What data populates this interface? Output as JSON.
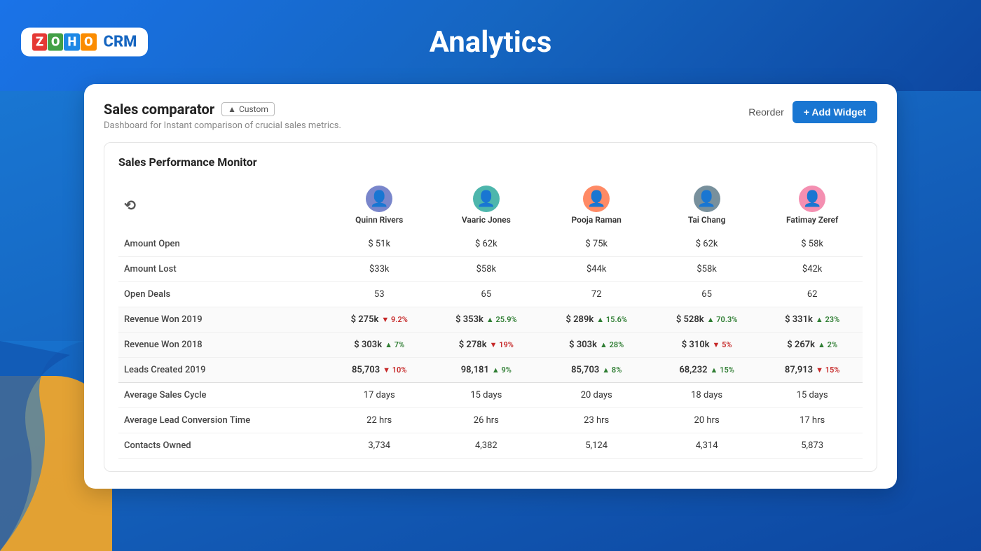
{
  "header": {
    "title": "Analytics",
    "logo_letters": [
      "Z",
      "O",
      "H",
      "O"
    ],
    "crm_text": "CRM"
  },
  "dashboard": {
    "title": "Sales comparator",
    "badge": "Custom",
    "subtitle": "Dashboard for Instant comparison of crucial sales metrics.",
    "reorder_label": "Reorder",
    "add_widget_label": "+ Add Widget"
  },
  "widget": {
    "title": "Sales Performance Monitor",
    "refresh_icon": "↻"
  },
  "columns": [
    {
      "name": "Quinn Rivers",
      "avatar": "👤",
      "color": "#7986cb"
    },
    {
      "name": "Vaaric Jones",
      "avatar": "👤",
      "color": "#4db6ac"
    },
    {
      "name": "Pooja Raman",
      "avatar": "👤",
      "color": "#ff8a65"
    },
    {
      "name": "Tai Chang",
      "avatar": "👤",
      "color": "#78909c"
    },
    {
      "name": "Fatimay Zeref",
      "avatar": "👤",
      "color": "#f48fb1"
    }
  ],
  "rows": [
    {
      "label": "Amount Open",
      "values": [
        "$ 51k",
        "$ 62k",
        "$ 75k",
        "$ 62k",
        "$ 58k"
      ],
      "highlight": false
    },
    {
      "label": "Amount Lost",
      "values": [
        "$33k",
        "$58k",
        "$44k",
        "$58k",
        "$42k"
      ],
      "highlight": false
    },
    {
      "label": "Open Deals",
      "values": [
        "53",
        "65",
        "72",
        "65",
        "62"
      ],
      "highlight": false
    },
    {
      "label": "Revenue Won 2019",
      "values": [
        "$ 275k",
        "$ 353k",
        "$ 289k",
        "$ 528k",
        "$ 331k"
      ],
      "trends": [
        {
          "dir": "down",
          "pct": "9.2%"
        },
        {
          "dir": "up",
          "pct": "25.9%"
        },
        {
          "dir": "up",
          "pct": "15.6%"
        },
        {
          "dir": "up",
          "pct": "70.3%"
        },
        {
          "dir": "up",
          "pct": "23%"
        }
      ],
      "highlight": true
    },
    {
      "label": "Revenue Won 2018",
      "values": [
        "$ 303k",
        "$ 278k",
        "$ 303k",
        "$ 310k",
        "$ 267k"
      ],
      "trends": [
        {
          "dir": "up",
          "pct": "7%"
        },
        {
          "dir": "down",
          "pct": "19%"
        },
        {
          "dir": "up",
          "pct": "28%"
        },
        {
          "dir": "down",
          "pct": "5%"
        },
        {
          "dir": "up",
          "pct": "2%"
        }
      ],
      "highlight": true
    },
    {
      "label": "Leads Created 2019",
      "values": [
        "85,703",
        "98,181",
        "85,703",
        "68,232",
        "87,913"
      ],
      "trends": [
        {
          "dir": "down",
          "pct": "10%"
        },
        {
          "dir": "up",
          "pct": "9%"
        },
        {
          "dir": "up",
          "pct": "8%"
        },
        {
          "dir": "up",
          "pct": "15%"
        },
        {
          "dir": "down",
          "pct": "15%"
        }
      ],
      "highlight": true
    },
    {
      "label": "Average Sales Cycle",
      "values": [
        "17 days",
        "15 days",
        "20 days",
        "18 days",
        "15 days"
      ],
      "highlight": false
    },
    {
      "label": "Average Lead Conversion Time",
      "values": [
        "22 hrs",
        "26 hrs",
        "23 hrs",
        "20 hrs",
        "17 hrs"
      ],
      "highlight": false
    },
    {
      "label": "Contacts Owned",
      "values": [
        "3,734",
        "4,382",
        "5,124",
        "4,314",
        "5,873"
      ],
      "highlight": false
    }
  ]
}
